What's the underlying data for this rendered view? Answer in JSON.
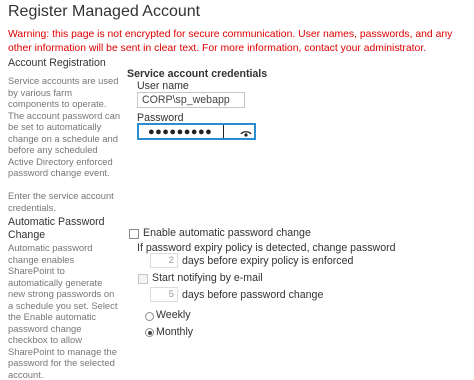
{
  "page": {
    "title": "Register Managed Account",
    "warning": "Warning: this page is not encrypted for secure communication. User names, passwords, and any other information will be sent in clear text. For more information, contact your administrator."
  },
  "account_registration": {
    "title": "Account Registration",
    "desc_lines": [
      "Service accounts are used",
      "by various farm",
      "components to operate.",
      "The account password can",
      "be set to automatically",
      "change on a schedule and",
      "before any scheduled",
      "Active Directory enforced",
      "password change event.",
      "",
      "Enter the service account",
      "credentials."
    ],
    "group_title": "Service account credentials",
    "username_label": "User name",
    "username_value": "CORP\\sp_webapp",
    "password_label": "Password",
    "password_mask": "●●●●●●●●●",
    "reveal_icon": "eye-icon"
  },
  "auto_change": {
    "title_lines": [
      "Automatic Password",
      "Change"
    ],
    "desc_lines": [
      "Automatic password",
      "change enables",
      "SharePoint to",
      "automatically generate",
      "new strong passwords on",
      "a schedule you set. Select",
      "the Enable automatic",
      "password change",
      "checkbox to allow",
      "SharePoint to manage the",
      "password for the selected",
      "account."
    ],
    "enable_label": "Enable automatic password change",
    "expiry_text": "If password expiry policy is detected, change password",
    "expiry_days_value": "2",
    "expiry_days_text": "days before expiry policy is enforced",
    "notify_label": "Start notifying by e-mail",
    "notify_days_value": "5",
    "notify_days_text": "days before password change",
    "weekly_label": "Weekly",
    "monthly_label": "Monthly"
  }
}
